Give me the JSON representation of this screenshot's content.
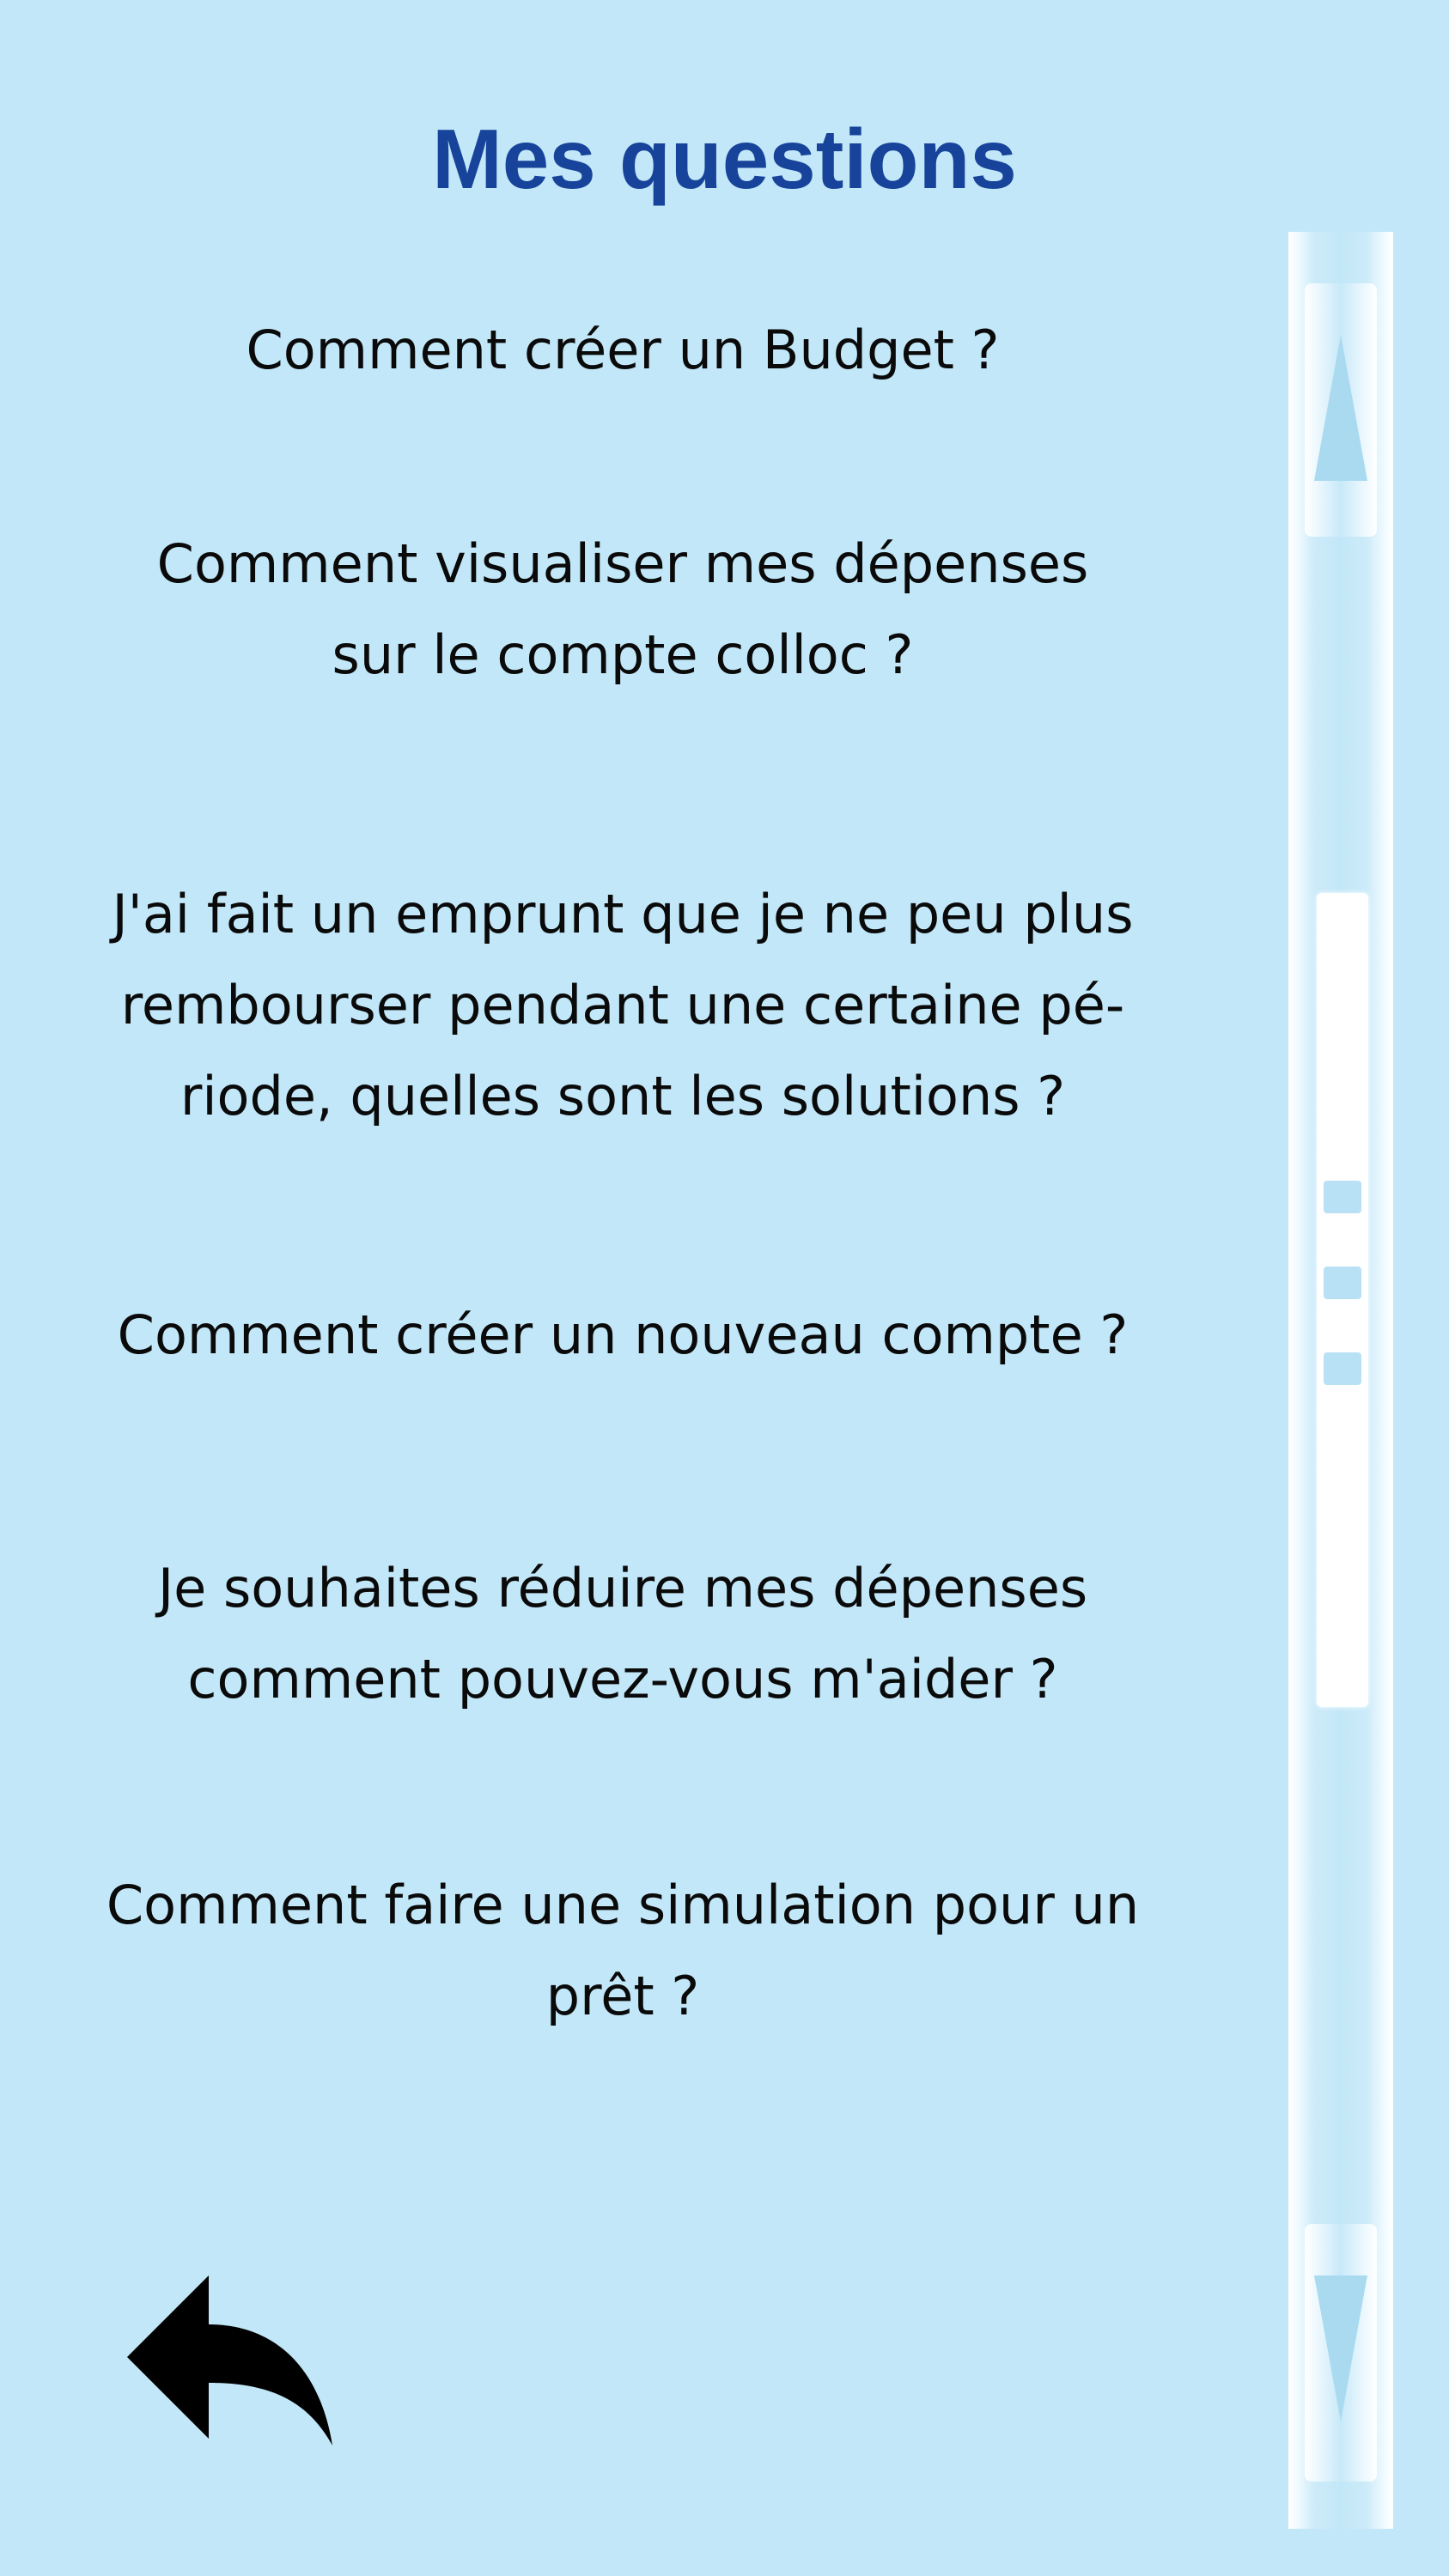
{
  "page": {
    "title": "Mes questions"
  },
  "questions": [
    "Comment créer un Budget ?",
    "Comment visualiser mes dépenses\nsur le compte colloc ?",
    "J'ai fait un emprunt que je ne peu plus\nrembourser pendant une certaine pé-\nriode, quelles sont les solutions ?",
    "Comment créer un nouveau compte ?",
    "Je souhaites réduire mes dépenses\ncomment pouvez-vous m'aider ?",
    "Comment faire une simulation pour un\nprêt ?"
  ],
  "icons": {
    "back": "back-arrow-icon",
    "scroll_up": "scroll-up-arrow-icon",
    "scroll_down": "scroll-down-arrow-icon"
  },
  "colors": {
    "background": "#c2e7f8",
    "title": "#17449a",
    "text": "#0a0a0a"
  }
}
